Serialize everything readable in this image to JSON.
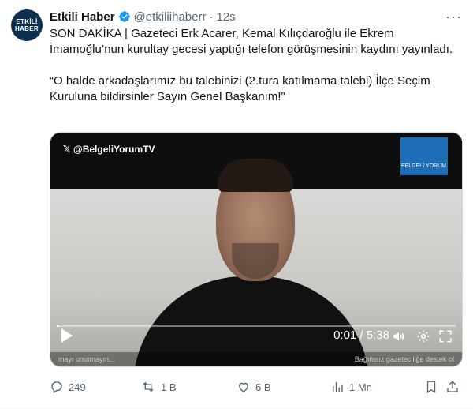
{
  "author": {
    "avatar_text_1": "ETKİLİ",
    "avatar_text_2": "HABER",
    "name": "Etkili Haber",
    "handle": "@etkiliihaberr",
    "separator": "·",
    "time": "12s",
    "verified_color": "#1d9bf0"
  },
  "tweet": {
    "text": "SON DAKİKA | Gazeteci Erk Acarer, Kemal Kılıçdaroğlu ile Ekrem İmamoğlu’nun kurultay gecesi yaptığı telefon görüşmesinin kaydını yayınladı.\n\n“O halde arkadaşlarımız bu talebinizi (2.tura katılmama talebi) İlçe Seçim Kuruluna bildirsinler Sayın Genel Başkanım!”"
  },
  "video": {
    "channel_tag": "@BelgeliYorumTV",
    "logo_text": "BELGELİ YORUM",
    "ticker_left": "mayı unutmayın...",
    "ticker_right": "Bağımsız gazeteciliğe destek ol",
    "current_time": "0:01",
    "time_separator": " / ",
    "duration": "5:38",
    "progress": 0.003
  },
  "actions": {
    "reply_count": "249",
    "retweet_count": "1 B",
    "like_count": "6 B",
    "views_count": "1 Mn"
  },
  "icons": {
    "more": "more-icon",
    "reply": "reply-icon",
    "retweet": "retweet-icon",
    "like": "heart-icon",
    "views": "views-icon",
    "bookmark": "bookmark-icon",
    "share": "share-icon"
  }
}
